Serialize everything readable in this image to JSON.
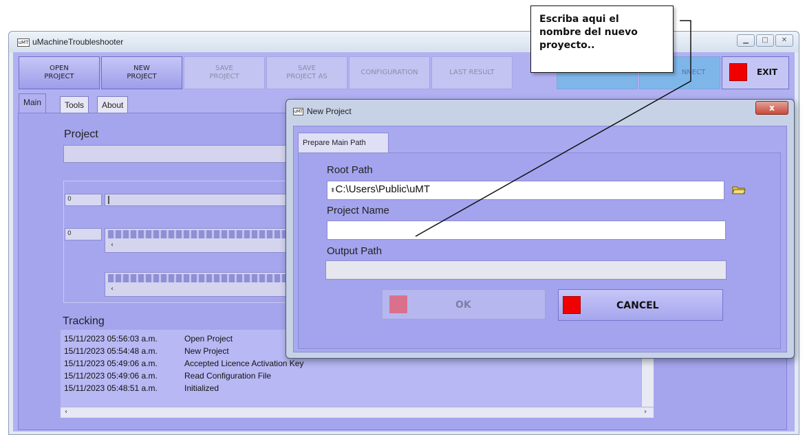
{
  "window": {
    "title": "uMachineTroubleshooter",
    "logo_text": "uMT"
  },
  "toolbar": {
    "open_project": "OPEN\nPROJECT",
    "new_project": "NEW\nPROJECT",
    "save_project": "SAVE\nPROJECT",
    "save_project_as": "SAVE\nPROJECT AS",
    "configuration": "CONFIGURATION",
    "last_result": "LAST RESULT",
    "connect_partial": "",
    "disconnect_partial": "NNECT",
    "exit": "EXIT"
  },
  "tabs": [
    "Main",
    "Tools",
    "About"
  ],
  "main": {
    "project_label": "Project",
    "field1_value": "0",
    "field2_value": "0",
    "tracking_label": "Tracking",
    "log": [
      {
        "time": "15/11/2023 05:56:03 a.m.",
        "event": "Open Project"
      },
      {
        "time": "15/11/2023 05:54:48 a.m.",
        "event": "New Project"
      },
      {
        "time": "15/11/2023 05:49:06 a.m.",
        "event": "Accepted Licence Activation Key"
      },
      {
        "time": "15/11/2023 05:49:06 a.m.",
        "event": "Read Configuration File"
      },
      {
        "time": "15/11/2023 05:48:51 a.m.",
        "event": "Initialized"
      }
    ]
  },
  "dialog": {
    "title": "New Project",
    "logo_text": "uMT",
    "close": "x",
    "tab": "Prepare Main Path",
    "root_path_label": "Root Path",
    "root_path_value": "C:\\Users\\Public\\uMT",
    "project_name_label": "Project Name",
    "project_name_value": "",
    "output_path_label": "Output Path",
    "output_path_value": "",
    "ok": "OK",
    "cancel": "CANCEL"
  },
  "callout": {
    "text": "Escriba aqui el\nnombre del nuevo\nproyecto.."
  },
  "colors": {
    "panel": "#b1b1f2",
    "exit_red": "#f00000",
    "ok_square": "#d9718d"
  },
  "icons": [
    "app-logo-icon",
    "folder-open-icon",
    "minimize-icon",
    "maximize-icon",
    "close-icon"
  ]
}
